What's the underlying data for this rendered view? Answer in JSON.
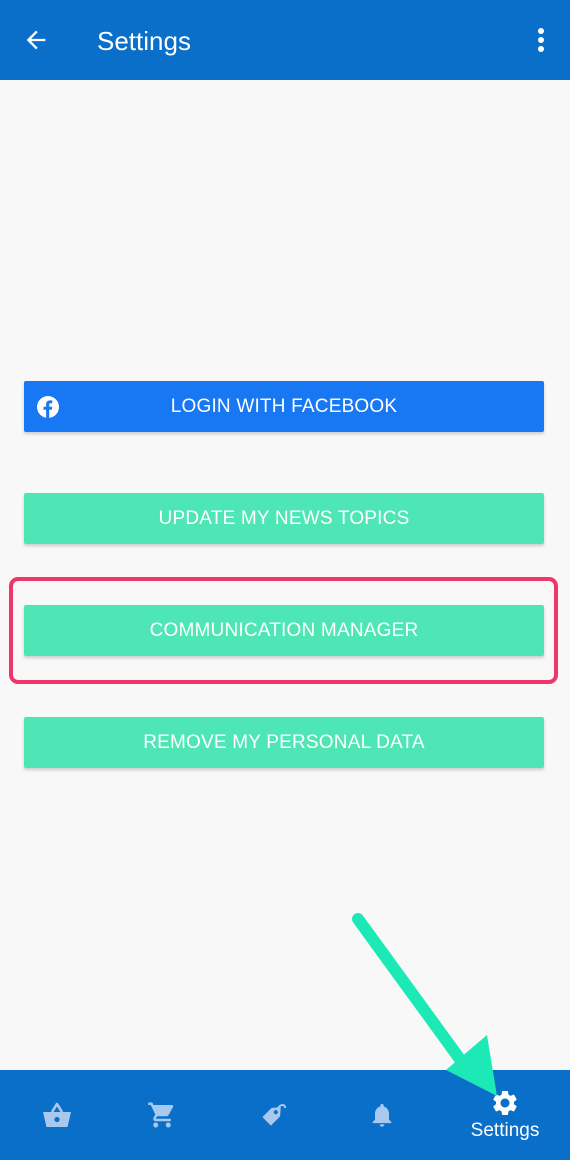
{
  "app_bar": {
    "title": "Settings",
    "back_icon": "arrow-left-icon",
    "menu_icon": "more-vert-icon",
    "color": "#0a6fc9"
  },
  "buttons": {
    "facebook": {
      "label": "LOGIN WITH FACEBOOK",
      "icon": "facebook-icon",
      "color": "#1877f2"
    },
    "news_topics": {
      "label": "UPDATE MY NEWS TOPICS",
      "color": "#4ee6b5"
    },
    "communication": {
      "label": "COMMUNICATION MANAGER",
      "color": "#4ee6b5"
    },
    "remove_data": {
      "label": "REMOVE MY PERSONAL DATA",
      "color": "#4ee6b5"
    }
  },
  "annotation": {
    "highlight_color": "#f0356d",
    "arrow_color": "#1de9b6"
  },
  "bottom_nav": {
    "items": [
      {
        "icon": "basket-icon",
        "label": ""
      },
      {
        "icon": "cart-icon",
        "label": ""
      },
      {
        "icon": "tag-icon",
        "label": ""
      },
      {
        "icon": "bell-icon",
        "label": ""
      },
      {
        "icon": "gear-icon",
        "label": "Settings",
        "active": true
      }
    ]
  }
}
